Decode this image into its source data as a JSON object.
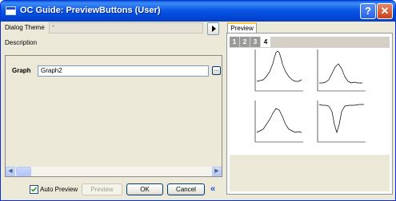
{
  "window": {
    "title": "OC Guide: PreviewButtons (User)",
    "help_button": "?",
    "close_button": "✕"
  },
  "dialog_theme": {
    "label": "Dialog Theme",
    "value": "*"
  },
  "description_label": "Description",
  "graph": {
    "label": "Graph",
    "value": "Graph2",
    "browse_label": "..."
  },
  "footer": {
    "auto_preview_label": "Auto Preview",
    "auto_preview_checked": true,
    "preview_button": "Preview",
    "ok_button": "OK",
    "cancel_button": "Cancel",
    "collapse_icon": "«"
  },
  "preview_tab": {
    "label": "Preview",
    "pages": [
      "1",
      "2",
      "3",
      "4"
    ],
    "active_page": "4"
  }
}
